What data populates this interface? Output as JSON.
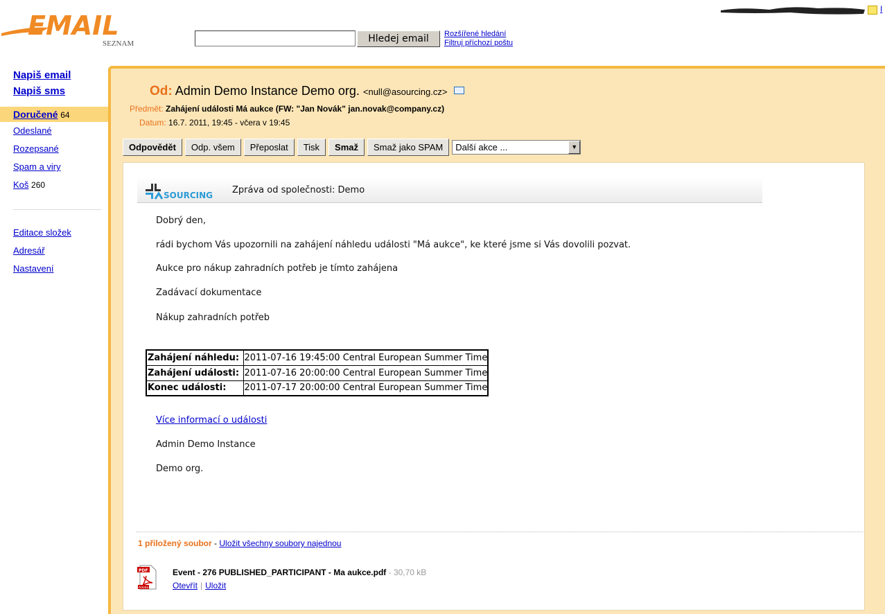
{
  "header": {
    "logo_text": "EMAIL",
    "logo_sub": "SEZNAM",
    "search_value": "",
    "search_button": "Hledej email",
    "advanced_search": "Rozšířené hledání",
    "filter_mail": "Filtruj příchozí poštu",
    "edge_link": "I"
  },
  "sidebar": {
    "compose_email": "Napiš email",
    "compose_sms": "Napiš sms",
    "folders": [
      {
        "label": "Doručené",
        "count": "64"
      },
      {
        "label": "Odeslané",
        "count": ""
      },
      {
        "label": "Rozepsané",
        "count": ""
      },
      {
        "label": "Spam a viry",
        "count": ""
      },
      {
        "label": "Koš",
        "count": "260"
      }
    ],
    "tools": [
      "Editace složek",
      "Adresář",
      "Nastavení"
    ]
  },
  "message": {
    "from_label": "Od:",
    "from_name": "Admin Demo Instance Demo org.",
    "from_address": "<null@asourcing.cz>",
    "subject_label": "Předmět:",
    "subject": "Zahájení události Má aukce (FW: \"Jan Novák\" jan.novak@company.cz)",
    "date_label": "Datum:",
    "date": "16.7. 2011, 19:45 - včera v 19:45"
  },
  "toolbar": {
    "reply": "Odpovědět",
    "reply_all": "Odp. všem",
    "forward": "Přeposlat",
    "print": "Tisk",
    "delete": "Smaž",
    "delete_spam": "Smaž jako SPAM",
    "more_actions": "Další akce ..."
  },
  "body": {
    "logo_text": "SOURCING",
    "head_title": "Zpráva od společnosti: Demo",
    "greeting": "Dobrý den,",
    "intro": "rádi bychom Vás upozornili na zahájení náhledu události \"Má aukce\", ke které jsme si Vás dovolili pozvat.",
    "line1": "Aukce pro nákup zahradních potřeb je tímto zahájena",
    "line2": "Zadávací dokumentace",
    "line3": "Nákup zahradních potřeb",
    "table": [
      {
        "key": "Zahájení náhledu:",
        "value": "2011-07-16 19:45:00 Central European Summer Time"
      },
      {
        "key": "Zahájení události:",
        "value": "2011-07-16 20:00:00 Central European Summer Time"
      },
      {
        "key": "Konec události:",
        "value": "2011-07-17 20:00:00 Central European Summer Time"
      }
    ],
    "more_info_link": "Více informací o události",
    "signature1": "Admin Demo Instance",
    "signature2": "Demo org."
  },
  "attachments": {
    "count_label": "1 přiložený soubor",
    "separator": " - ",
    "save_all": "Uložit všechny soubory najednou",
    "file_name": "Event - 276 PUBLISHED_PARTICIPANT - Ma aukce.pdf",
    "file_size": " - 30,70 kB",
    "open": "Otevřít",
    "save": "Uložit",
    "pdf_label": "PDF",
    "adobe_label": "Adobe"
  }
}
